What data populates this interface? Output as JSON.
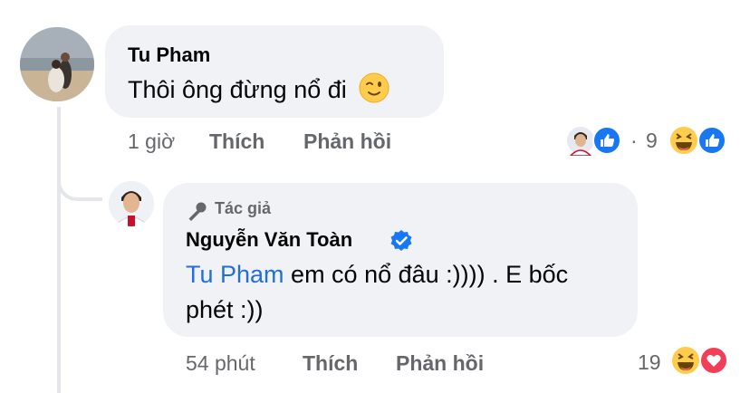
{
  "comment": {
    "author": "Tu Pham",
    "text": "Thôi ông đừng nổ đi",
    "time": "1 giờ",
    "like_label": "Thích",
    "reply_label": "Phản hồi",
    "reaction_count": "9",
    "separator": "·"
  },
  "reply": {
    "badge_label": "Tác giả",
    "author": "Nguyễn Văn Toàn",
    "mention": "Tu Pham",
    "text_line1": " em có nổ đâu :)))) . E bốc",
    "text_line2": "phét :))",
    "time": "54 phút",
    "like_label": "Thích",
    "reply_label": "Phản hồi",
    "reaction_count": "19"
  },
  "colors": {
    "bubble": "#f0f2f5",
    "meta_text": "#65676b",
    "mention": "#216fdb",
    "like_blue": "#1877f2",
    "love_red": "#f33e58",
    "verified": "#1877f2"
  }
}
